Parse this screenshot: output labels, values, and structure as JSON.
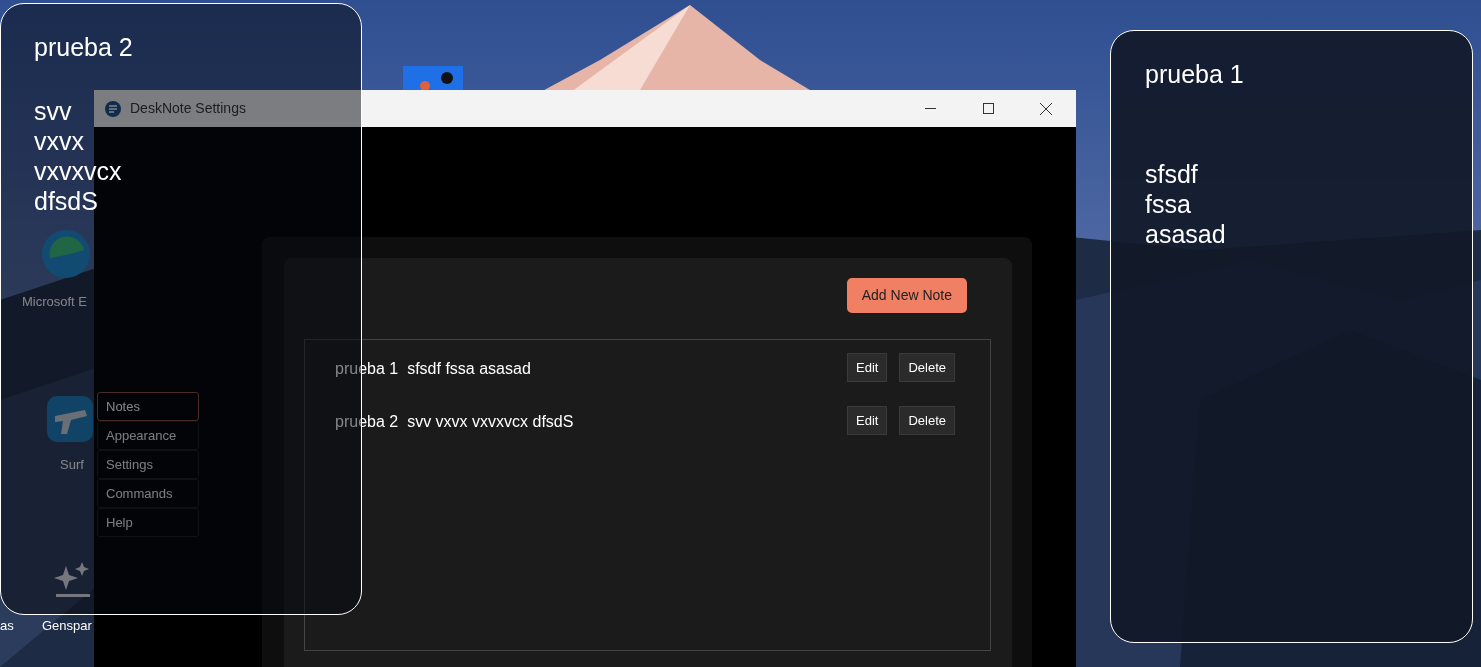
{
  "desktop": {
    "icons": [
      {
        "label": "Microsoft E",
        "kind": "browser"
      },
      {
        "label": "Surf",
        "kind": "plane"
      },
      {
        "label": "as",
        "kind": "none"
      },
      {
        "label": "Genspar",
        "kind": "sparkle"
      }
    ]
  },
  "settings_window": {
    "title": "DeskNote Settings",
    "nav": [
      {
        "label": "Notes",
        "selected": true
      },
      {
        "label": "Appearance",
        "selected": false
      },
      {
        "label": "Settings",
        "selected": false
      },
      {
        "label": "Commands",
        "selected": false
      },
      {
        "label": "Help",
        "selected": false
      }
    ],
    "add_button": "Add New Note",
    "notes": [
      {
        "title": "prueba 1",
        "content": "sfsdf fssa asasad",
        "actions": [
          "Edit",
          "Delete"
        ]
      },
      {
        "title": "prueba 2",
        "content": "svv vxvx vxvxvcx dfsdS",
        "actions": [
          "Edit",
          "Delete"
        ]
      }
    ]
  },
  "sticky_notes": [
    {
      "title": "prueba 2",
      "lines": [
        "svv",
        "vxvx",
        "vxvxvcx",
        "dfsdS"
      ]
    },
    {
      "title": "prueba 1",
      "lines": [
        "sfsdf",
        "fssa",
        "asasad"
      ]
    }
  ]
}
